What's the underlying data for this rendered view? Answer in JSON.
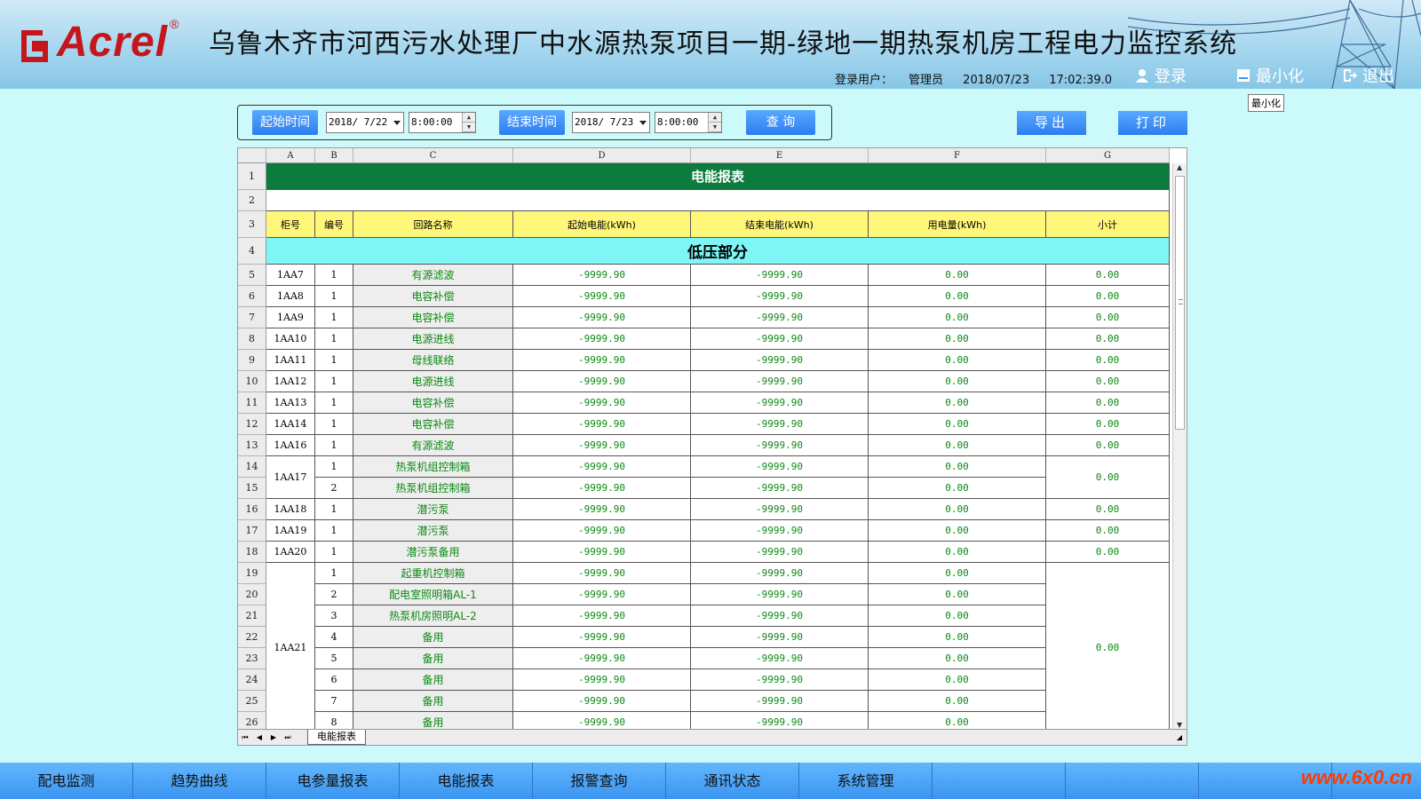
{
  "header": {
    "logo_text": "Acrel",
    "logo_reg": "®",
    "title": "乌鲁木齐市河西污水处理厂中水源热泵项目一期-绿地一期热泵机房工程电力监控系统",
    "login_user_label": "登录用户：",
    "login_user": "管理员",
    "date": "2018/07/23",
    "time": "17:02:39.0",
    "login_button": "登录",
    "minimize_button": "最小化",
    "exit_button": "退出",
    "tooltip": "最小化"
  },
  "query": {
    "start_label": "起始时间",
    "start_date": "2018/ 7/22",
    "start_time": "8:00:00",
    "end_label": "结束时间",
    "end_date": "2018/ 7/23",
    "end_time": "8:00:00",
    "query_button": "查 询",
    "export_button": "导出",
    "print_button": "打印"
  },
  "sheet": {
    "columns": [
      "A",
      "B",
      "C",
      "D",
      "E",
      "F",
      "G"
    ],
    "report_title": "电能报表",
    "headers": [
      "柜号",
      "编号",
      "回路名称",
      "起始电能(kWh)",
      "结束电能(kWh)",
      "用电量(kWh)",
      "小计"
    ],
    "section": "低压部分",
    "rows": [
      {
        "no": "5",
        "cabinet": "1AA7",
        "num": "1",
        "name": "有源滤波",
        "start": "-9999.90",
        "end": "-9999.90",
        "usage": "0.00",
        "subtotal": "0.00"
      },
      {
        "no": "6",
        "cabinet": "1AA8",
        "num": "1",
        "name": "电容补偿",
        "start": "-9999.90",
        "end": "-9999.90",
        "usage": "0.00",
        "subtotal": "0.00"
      },
      {
        "no": "7",
        "cabinet": "1AA9",
        "num": "1",
        "name": "电容补偿",
        "start": "-9999.90",
        "end": "-9999.90",
        "usage": "0.00",
        "subtotal": "0.00"
      },
      {
        "no": "8",
        "cabinet": "1AA10",
        "num": "1",
        "name": "电源进线",
        "start": "-9999.90",
        "end": "-9999.90",
        "usage": "0.00",
        "subtotal": "0.00"
      },
      {
        "no": "9",
        "cabinet": "1AA11",
        "num": "1",
        "name": "母线联络",
        "start": "-9999.90",
        "end": "-9999.90",
        "usage": "0.00",
        "subtotal": "0.00"
      },
      {
        "no": "10",
        "cabinet": "1AA12",
        "num": "1",
        "name": "电源进线",
        "start": "-9999.90",
        "end": "-9999.90",
        "usage": "0.00",
        "subtotal": "0.00"
      },
      {
        "no": "11",
        "cabinet": "1AA13",
        "num": "1",
        "name": "电容补偿",
        "start": "-9999.90",
        "end": "-9999.90",
        "usage": "0.00",
        "subtotal": "0.00"
      },
      {
        "no": "12",
        "cabinet": "1AA14",
        "num": "1",
        "name": "电容补偿",
        "start": "-9999.90",
        "end": "-9999.90",
        "usage": "0.00",
        "subtotal": "0.00"
      },
      {
        "no": "13",
        "cabinet": "1AA16",
        "num": "1",
        "name": "有源滤波",
        "start": "-9999.90",
        "end": "-9999.90",
        "usage": "0.00",
        "subtotal": "0.00"
      },
      {
        "no": "14",
        "cabinet": "1AA17",
        "num": "1",
        "name": "热泵机组控制箱",
        "start": "-9999.90",
        "end": "-9999.90",
        "usage": "0.00",
        "subtotal": "0.00"
      },
      {
        "no": "15",
        "cabinet": "",
        "num": "2",
        "name": "热泵机组控制箱",
        "start": "-9999.90",
        "end": "-9999.90",
        "usage": "0.00",
        "subtotal": ""
      },
      {
        "no": "16",
        "cabinet": "1AA18",
        "num": "1",
        "name": "潜污泵",
        "start": "-9999.90",
        "end": "-9999.90",
        "usage": "0.00",
        "subtotal": "0.00"
      },
      {
        "no": "17",
        "cabinet": "1AA19",
        "num": "1",
        "name": "潜污泵",
        "start": "-9999.90",
        "end": "-9999.90",
        "usage": "0.00",
        "subtotal": "0.00"
      },
      {
        "no": "18",
        "cabinet": "1AA20",
        "num": "1",
        "name": "潜污泵备用",
        "start": "-9999.90",
        "end": "-9999.90",
        "usage": "0.00",
        "subtotal": "0.00"
      },
      {
        "no": "19",
        "cabinet": "1AA21",
        "num": "1",
        "name": "起重机控制箱",
        "start": "-9999.90",
        "end": "-9999.90",
        "usage": "0.00",
        "subtotal": "0.00"
      },
      {
        "no": "20",
        "cabinet": "",
        "num": "2",
        "name": "配电室照明箱AL-1",
        "start": "-9999.90",
        "end": "-9999.90",
        "usage": "0.00",
        "subtotal": ""
      },
      {
        "no": "21",
        "cabinet": "",
        "num": "3",
        "name": "热泵机房照明AL-2",
        "start": "-9999.90",
        "end": "-9999.90",
        "usage": "0.00",
        "subtotal": ""
      },
      {
        "no": "22",
        "cabinet": "",
        "num": "4",
        "name": "备用",
        "start": "-9999.90",
        "end": "-9999.90",
        "usage": "0.00",
        "subtotal": ""
      },
      {
        "no": "23",
        "cabinet": "",
        "num": "5",
        "name": "备用",
        "start": "-9999.90",
        "end": "-9999.90",
        "usage": "0.00",
        "subtotal": ""
      },
      {
        "no": "24",
        "cabinet": "",
        "num": "6",
        "name": "备用",
        "start": "-9999.90",
        "end": "-9999.90",
        "usage": "0.00",
        "subtotal": ""
      },
      {
        "no": "25",
        "cabinet": "",
        "num": "7",
        "name": "备用",
        "start": "-9999.90",
        "end": "-9999.90",
        "usage": "0.00",
        "subtotal": ""
      },
      {
        "no": "26",
        "cabinet": "",
        "num": "8",
        "name": "备用",
        "start": "-9999.90",
        "end": "-9999.90",
        "usage": "0.00",
        "subtotal": ""
      }
    ],
    "tab_name": "电能报表",
    "nav_first": "⏮",
    "nav_prev": "◀",
    "nav_next": "▶",
    "nav_last": "⏭"
  },
  "bottom_nav": [
    "配电监测",
    "趋势曲线",
    "电参量报表",
    "电能报表",
    "报警查询",
    "通讯状态",
    "系统管理",
    "",
    "",
    ""
  ],
  "watermark": "www.6x0.cn",
  "colors": {
    "background": "#ccfafa",
    "title_fill": "#0d7a3e",
    "header_fill": "#fff77a",
    "section_fill": "#7ff6f6",
    "value_text": "#0a8a12",
    "button_blue": "#2c7ef0",
    "logo_red": "#c4161c"
  },
  "icons": {
    "login": "user-icon",
    "minimize": "minimize-icon",
    "exit": "exit-icon"
  }
}
